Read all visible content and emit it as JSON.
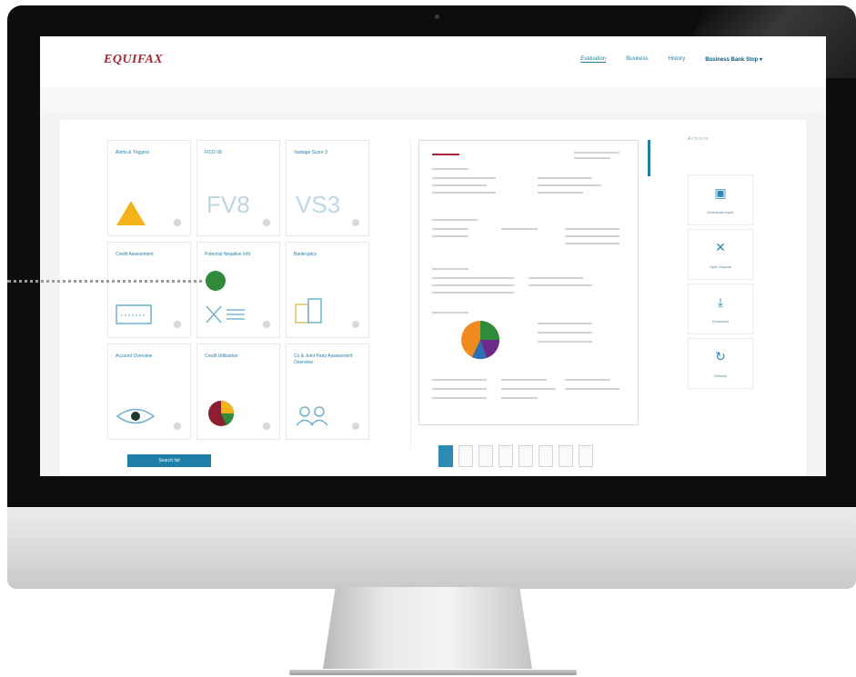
{
  "app": {
    "logo": "EQUIFAX"
  },
  "nav": {
    "items": [
      "Evaluation",
      "Business",
      "History"
    ],
    "user": "Business Bank Stop"
  },
  "tiles": [
    {
      "title": "Alerts & Triggers",
      "icon": "warning-triangle-icon"
    },
    {
      "title": "FICO 08",
      "code": "FV8",
      "icon": "gear-dot-icon"
    },
    {
      "title": "Vantage Score 3",
      "code": "VS3",
      "icon": "gear-dot-icon"
    },
    {
      "title": "Credit Assessment",
      "icon": "checkbook-icon"
    },
    {
      "title": "Potential Negative Info",
      "icon": "x-list-icon"
    },
    {
      "title": "Bankruptcy",
      "icon": "building-icon"
    },
    {
      "title": "Account Overview",
      "icon": "eye-icon"
    },
    {
      "title": "Credit Utilization",
      "icon": "pie-chart-icon"
    },
    {
      "title": "Co & Joint Party Assessment Overview",
      "icon": "people-icon"
    }
  ],
  "button": {
    "label": "Search list"
  },
  "actions": {
    "title": "Actions",
    "items": [
      {
        "label": "Download report",
        "icon": "file-icon"
      },
      {
        "label": "Open Dispute",
        "icon": "cross-icon"
      },
      {
        "label": "Download",
        "icon": "download-icon"
      },
      {
        "label": "Refresh",
        "icon": "refresh-icon"
      }
    ]
  },
  "colors": {
    "brand": "#a32638",
    "accent": "#1f7fa6",
    "callout": "#2f8a3a"
  }
}
